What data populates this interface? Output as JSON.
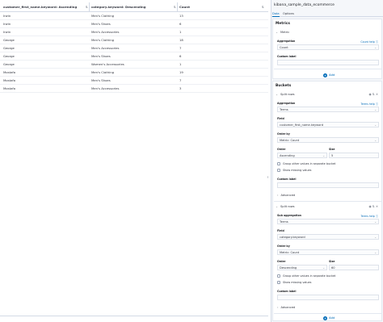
{
  "table": {
    "columns": [
      {
        "label": "customer_first_name.keyword: Ascending"
      },
      {
        "label": "category.keyword: Descending"
      },
      {
        "label": "Count"
      }
    ],
    "rows": [
      [
        "Irwin",
        "Men's Clothing",
        "13"
      ],
      [
        "Irwin",
        "Men's Shoes",
        "6"
      ],
      [
        "Irwin",
        "Men's Accessories",
        "1"
      ],
      [
        "George",
        "Men's Clothing",
        "18"
      ],
      [
        "George",
        "Men's Accessories",
        "7"
      ],
      [
        "George",
        "Men's Shoes",
        "6"
      ],
      [
        "George",
        "Women's Accessories",
        "1"
      ],
      [
        "Mostafa",
        "Men's Clothing",
        "19"
      ],
      [
        "Mostafa",
        "Men's Shoes",
        "7"
      ],
      [
        "Mostafa",
        "Men's Accessories",
        "3"
      ]
    ]
  },
  "editor": {
    "title": "kibana_sample_data_ecommerce",
    "tabs": [
      "Data",
      "Options"
    ],
    "metrics": {
      "title": "Metrics",
      "agg_head": "Metric",
      "aggregation_label": "Aggregation",
      "aggregation_help": "Count help",
      "aggregation_value": "Count",
      "custom_label": "Custom label",
      "add_label": "Add"
    },
    "buckets": {
      "title": "Buckets",
      "split1": {
        "head": "Split rows",
        "aggregation_label": "Aggregation",
        "aggregation_help": "Terms help",
        "aggregation_value": "Terms",
        "field_label": "Field",
        "field_value": "customer_first_name.keyword",
        "order_by_label": "Order by",
        "order_by_value": "Metric: Count",
        "order_label": "Order",
        "order_value": "Ascending",
        "size_label": "Size",
        "size_value": "5",
        "group_other": "Group other values in separate bucket",
        "show_missing": "Show missing values",
        "custom_label": "Custom label",
        "advanced": "Advanced"
      },
      "split2": {
        "head": "Split rows",
        "aggregation_label": "Sub aggregation",
        "aggregation_help": "Terms help",
        "aggregation_value": "Terms",
        "field_label": "Field",
        "field_value": "category.keyword",
        "order_by_label": "Order by",
        "order_by_value": "Metric: Count",
        "order_label": "Order",
        "order_value": "Descending",
        "size_label": "Size",
        "size_value": "60",
        "group_other": "Group other values in separate bucket",
        "show_missing": "Show missing values",
        "custom_label": "Custom label",
        "advanced": "Advanced"
      },
      "add_label": "Add"
    }
  }
}
